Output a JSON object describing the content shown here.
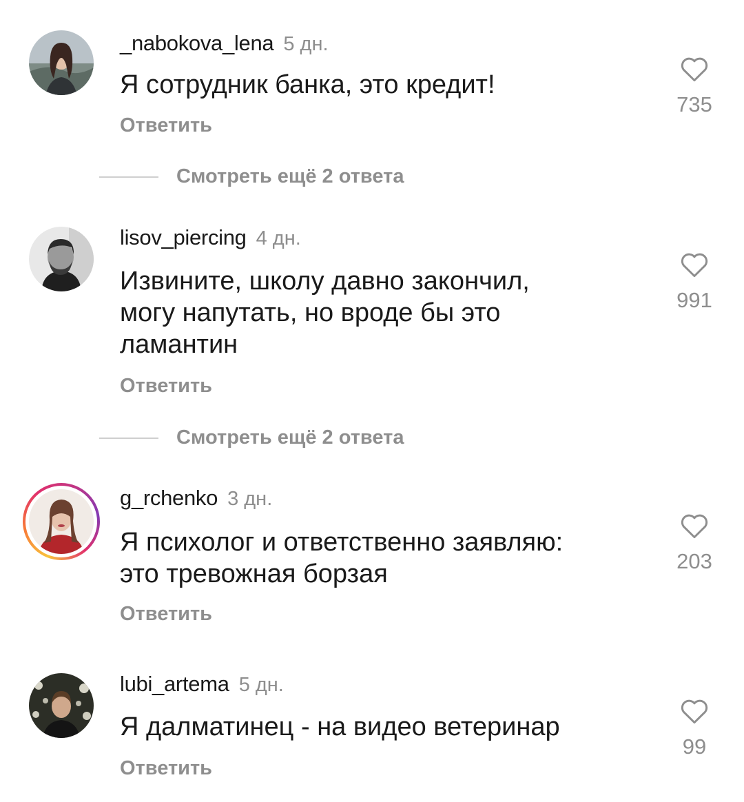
{
  "comments": [
    {
      "username": "_nabokova_lena",
      "time": "5 дн.",
      "text": "Я сотрудник банка, это кредит!",
      "reply_label": "Ответить",
      "likes": "735",
      "view_more": "Смотреть ещё 2 ответа",
      "has_story": false
    },
    {
      "username": "lisov_piercing",
      "time": "4 дн.",
      "text_lines": [
        "Извините, школу давно закончил,",
        "могу напутать, но вроде бы это",
        "ламантин"
      ],
      "reply_label": "Ответить",
      "likes": "991",
      "view_more": "Смотреть ещё 2 ответа",
      "has_story": false
    },
    {
      "username": "g_rchenko",
      "time": "3 дн.",
      "text_lines": [
        "Я психолог и ответственно заявляю:",
        "это тревожная борзая"
      ],
      "reply_label": "Ответить",
      "likes": "203",
      "has_story": true
    },
    {
      "username": "lubi_artema",
      "time": "5 дн.",
      "text": "Я далматинец - на видео ветеринар",
      "reply_label": "Ответить",
      "likes": "99",
      "has_story": false
    }
  ],
  "icons": {
    "like": "heart-outline-icon"
  },
  "colors": {
    "text": "#1a1a1a",
    "muted": "#8e8e8e",
    "divider": "#cfcfcf"
  }
}
